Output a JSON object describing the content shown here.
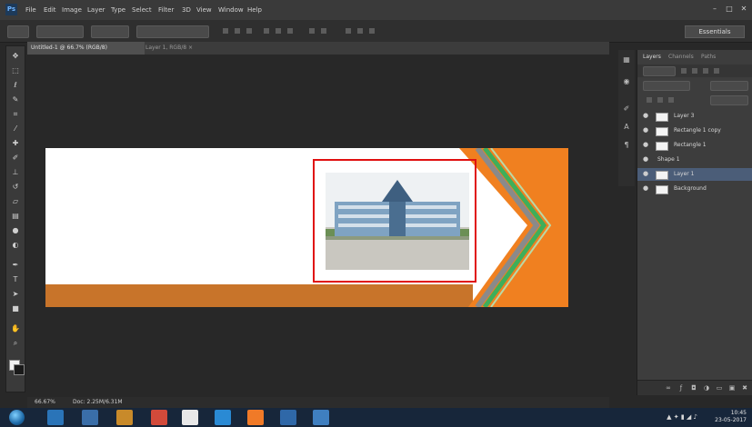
{
  "app": {
    "logo": "Ps",
    "menu": [
      "File",
      "Edit",
      "Image",
      "Layer",
      "Type",
      "Select",
      "Filter",
      "3D",
      "View",
      "Window",
      "Help"
    ]
  },
  "window_controls": [
    "–",
    "□",
    "✕"
  ],
  "options_bar": {
    "workspace": "Essentials"
  },
  "document": {
    "tab_title": "Untitled-1 @ 66.7% (RGB/8)",
    "other_tab": "Layer 1, RGB/8 ×",
    "zoom": "66.67%",
    "doc_size": "Doc: 2.25M/6.31M"
  },
  "icons": {
    "toolbar": [
      "move-tool-icon",
      "marquee-tool-icon",
      "lasso-tool-icon",
      "quick-select-tool-icon",
      "crop-tool-icon",
      "eyedropper-tool-icon",
      "healing-tool-icon",
      "brush-tool-icon",
      "clone-stamp-tool-icon",
      "history-brush-tool-icon",
      "eraser-tool-icon",
      "gradient-tool-icon",
      "blur-tool-icon",
      "dodge-tool-icon",
      "pen-tool-icon",
      "type-tool-icon",
      "path-select-tool-icon",
      "shape-tool-icon",
      "hand-tool-icon",
      "zoom-tool-icon"
    ]
  },
  "layers_panel": {
    "tabs": [
      "Layers",
      "Channels",
      "Paths"
    ],
    "layers": [
      {
        "name": "Layer 3"
      },
      {
        "name": "Rectangle 1 copy"
      },
      {
        "name": "Rectangle 1"
      },
      {
        "name": "Shape 1"
      },
      {
        "name": "Layer 1"
      },
      {
        "name": "Background"
      }
    ],
    "selected_index": 4
  },
  "colors": {
    "orange": "#f08020",
    "brown_stripe": "#c8742a",
    "green_chevron": "#3fae5a",
    "gray_chevron": "#8a8a8a",
    "selection_frame": "#e01010",
    "panel_bg": "#3d3d3d"
  },
  "taskbar": {
    "apps": [
      "start",
      "explorer",
      "media",
      "folder",
      "chrome",
      "gmail",
      "app-blue",
      "app-orange",
      "photoshop",
      "app-monitor"
    ],
    "clock_time": "10:45",
    "clock_date": "23-05-2017"
  }
}
